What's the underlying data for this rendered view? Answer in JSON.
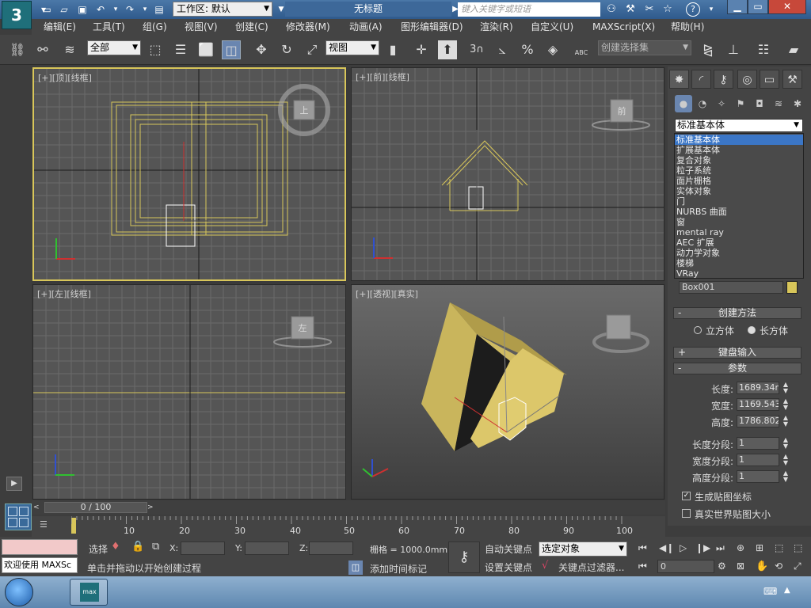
{
  "titlebar": {
    "workspace_label": "工作区: 默认",
    "title": "无标题",
    "search_placeholder": "键入关键字或短语",
    "help_icon_label": "?"
  },
  "menubar": {
    "items": [
      "编辑(E)",
      "工具(T)",
      "组(G)",
      "视图(V)",
      "创建(C)",
      "修改器(M)",
      "动画(A)",
      "图形编辑器(D)",
      "渲染(R)",
      "自定义(U)",
      "MAXScript(X)",
      "帮助(H)"
    ]
  },
  "toolbar": {
    "selection_filter": "全部",
    "ref_coord": "视图",
    "named_selection_placeholder": "创建选择集",
    "snap_label": "3",
    "percent_label": "%",
    "text_abc": "ABC"
  },
  "viewports": {
    "top": {
      "label": "[+][顶][线框]",
      "cube_label": "上"
    },
    "front": {
      "label": "[+][前][线框]",
      "cube_label": "前"
    },
    "left": {
      "label": "[+][左][线框]",
      "cube_label": "左"
    },
    "perspective": {
      "label": "[+][透视][真实]"
    }
  },
  "command_panel": {
    "type_selected": "标准基本体",
    "dropdown_items": [
      "标准基本体",
      "扩展基本体",
      "复合对象",
      "粒子系统",
      "面片栅格",
      "实体对象",
      "门",
      "NURBS 曲面",
      "窗",
      "mental ray",
      "AEC 扩展",
      "动力学对象",
      "楼梯",
      "VRay"
    ],
    "object_name": "Box001",
    "creation_method": {
      "title": "创建方法",
      "options": [
        "立方体",
        "长方体"
      ],
      "selected": "长方体"
    },
    "keyboard_entry": {
      "title": "键盘输入"
    },
    "parameters": {
      "title": "参数",
      "length_label": "长度:",
      "length_value": "1689.34m",
      "width_label": "宽度:",
      "width_value": "1169.543",
      "height_label": "高度:",
      "height_value": "1786.802",
      "length_segs_label": "长度分段:",
      "length_segs": "1",
      "width_segs_label": "宽度分段:",
      "width_segs": "1",
      "height_segs_label": "高度分段:",
      "height_segs": "1",
      "gen_mapping_label": "生成贴图坐标",
      "gen_mapping_checked": true,
      "real_world_label": "真实世界贴图大小",
      "real_world_checked": false
    }
  },
  "timeline": {
    "frame_display": "0 / 100",
    "ticks": [
      "10",
      "20",
      "30",
      "40",
      "50",
      "60",
      "70",
      "80",
      "90",
      "100"
    ]
  },
  "status": {
    "maxscript_welcome": "欢迎使用 MAXSc",
    "select_label": "选择",
    "x_label": "X:",
    "y_label": "Y:",
    "z_label": "Z:",
    "grid_label": "栅格 = 1000.0mm",
    "prompt": "单击并拖动以开始创建过程",
    "add_time_tag": "添加时间标记",
    "auto_key": "自动关键点",
    "set_key": "设置关键点",
    "key_mode": "选定对象",
    "key_filters": "关键点过滤器...",
    "current_frame": "0"
  },
  "colors": {
    "accent_yellow": "#d8c65a",
    "selection_blue": "#3b76c6"
  }
}
